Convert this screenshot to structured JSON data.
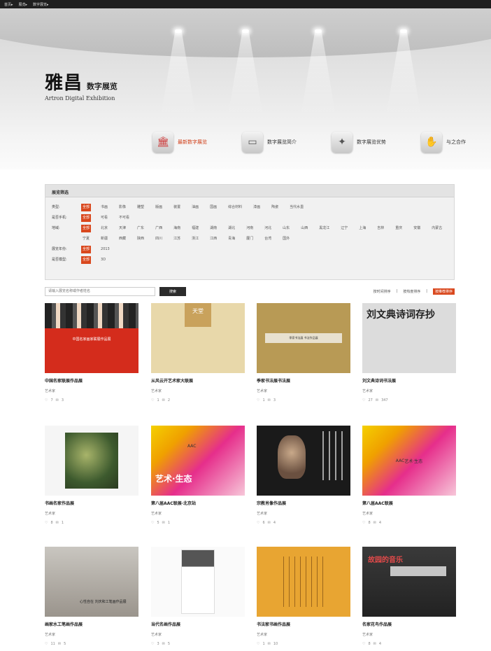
{
  "topbar": {
    "links": [
      "首页▸",
      "展览▸",
      "数字展览▸"
    ]
  },
  "brand": {
    "logo_cn": "雅昌",
    "logo_sub": "数字展览",
    "logo_en": "Artron Digital Exhibition"
  },
  "hero_nav": [
    {
      "label": "最新数字展览",
      "icon": "museum-icon",
      "active": true
    },
    {
      "label": "数字展览简介",
      "icon": "screen-icon",
      "active": false
    },
    {
      "label": "数字展览优势",
      "icon": "puzzle-icon",
      "active": false
    },
    {
      "label": "与之合作",
      "icon": "handshake-icon",
      "active": false
    }
  ],
  "filter": {
    "heading": "展览筛选",
    "rows": [
      {
        "label": "类型:",
        "options": [
          "全部",
          "书画",
          "影像",
          "雕塑",
          "版画",
          "装置",
          "油画",
          "国画",
          "综合材料",
          "漆画",
          "陶瓷",
          "当代水墨"
        ],
        "selected": 0
      },
      {
        "label": "是否手机:",
        "options": [
          "全部",
          "可看",
          "不可看"
        ],
        "selected": 0
      },
      {
        "label": "地域:",
        "options": [
          "全部",
          "北京",
          "天津",
          "广东",
          "广西",
          "海南",
          "福建",
          "湖南",
          "湖北",
          "河南",
          "河北",
          "山东",
          "山西",
          "黑龙江",
          "辽宁",
          "上海",
          "吉林",
          "重庆",
          "安徽",
          "内蒙古",
          "宁夏",
          "新疆",
          "西藏",
          "陕西",
          "四川",
          "江苏",
          "浙江",
          "江西",
          "青海",
          "厦门",
          "台湾",
          "国外"
        ],
        "selected": 0
      },
      {
        "label": "展览年份:",
        "options": [
          "全部",
          "2013"
        ],
        "selected": 0
      },
      {
        "label": "是否模型:",
        "options": [
          "全部",
          "3D"
        ],
        "selected": 0
      }
    ]
  },
  "search": {
    "placeholder": "请输入展览名称或作者姓名",
    "button": "搜索"
  },
  "sorts": [
    "按时间排序",
    "|",
    "按热度排序",
    "|",
    "按推荐排序"
  ],
  "cards": [
    {
      "title": "中国名家联展作品展",
      "artist": "艺术家",
      "likes": "7",
      "comments": "3",
      "thumb": "t1",
      "thumb_text": "中国名家画家联展作品展"
    },
    {
      "title": "从风云开艺术家大联展",
      "artist": "艺术家",
      "likes": "1",
      "comments": "2",
      "thumb": "t2",
      "thumb_text": "天堂"
    },
    {
      "title": "季家书法展书法展",
      "artist": "艺术家",
      "likes": "1",
      "comments": "3",
      "thumb": "t3",
      "thumb_text": "季家书法展 书法作品展"
    },
    {
      "title": "刘文典诗词书法展",
      "artist": "艺术家",
      "likes": "27",
      "comments": "347",
      "thumb": "t4",
      "thumb_text": "刘文典诗词存抄"
    },
    {
      "title": "书画名家作品展",
      "artist": "艺术家",
      "likes": "8",
      "comments": "1",
      "thumb": "t5",
      "thumb_text": ""
    },
    {
      "title": "第八届AAC联展·北京站",
      "artist": "艺术家",
      "likes": "5",
      "comments": "1",
      "thumb": "t6",
      "thumb_text": "艺术·生态"
    },
    {
      "title": "宗教肖像作品展",
      "artist": "艺术家",
      "likes": "6",
      "comments": "4",
      "thumb": "t7",
      "thumb_text": ""
    },
    {
      "title": "第八届AAC联展",
      "artist": "艺术家",
      "likes": "8",
      "comments": "4",
      "thumb": "t8",
      "thumb_text": "艺术·生态"
    },
    {
      "title": "画家水工笔画作品展",
      "artist": "艺术家",
      "likes": "11",
      "comments": "5",
      "thumb": "t9",
      "thumb_text": "心性自在 刘庆和工笔画作品展"
    },
    {
      "title": "当代名画作品展",
      "artist": "艺术家",
      "likes": "3",
      "comments": "5",
      "thumb": "t10",
      "thumb_text": ""
    },
    {
      "title": "书法家书画作品展",
      "artist": "艺术家",
      "likes": "1",
      "comments": "10",
      "thumb": "t11",
      "thumb_text": ""
    },
    {
      "title": "名家花鸟作品展",
      "artist": "艺术家",
      "likes": "8",
      "comments": "4",
      "thumb": "t12",
      "thumb_text": "故园的音乐"
    }
  ]
}
